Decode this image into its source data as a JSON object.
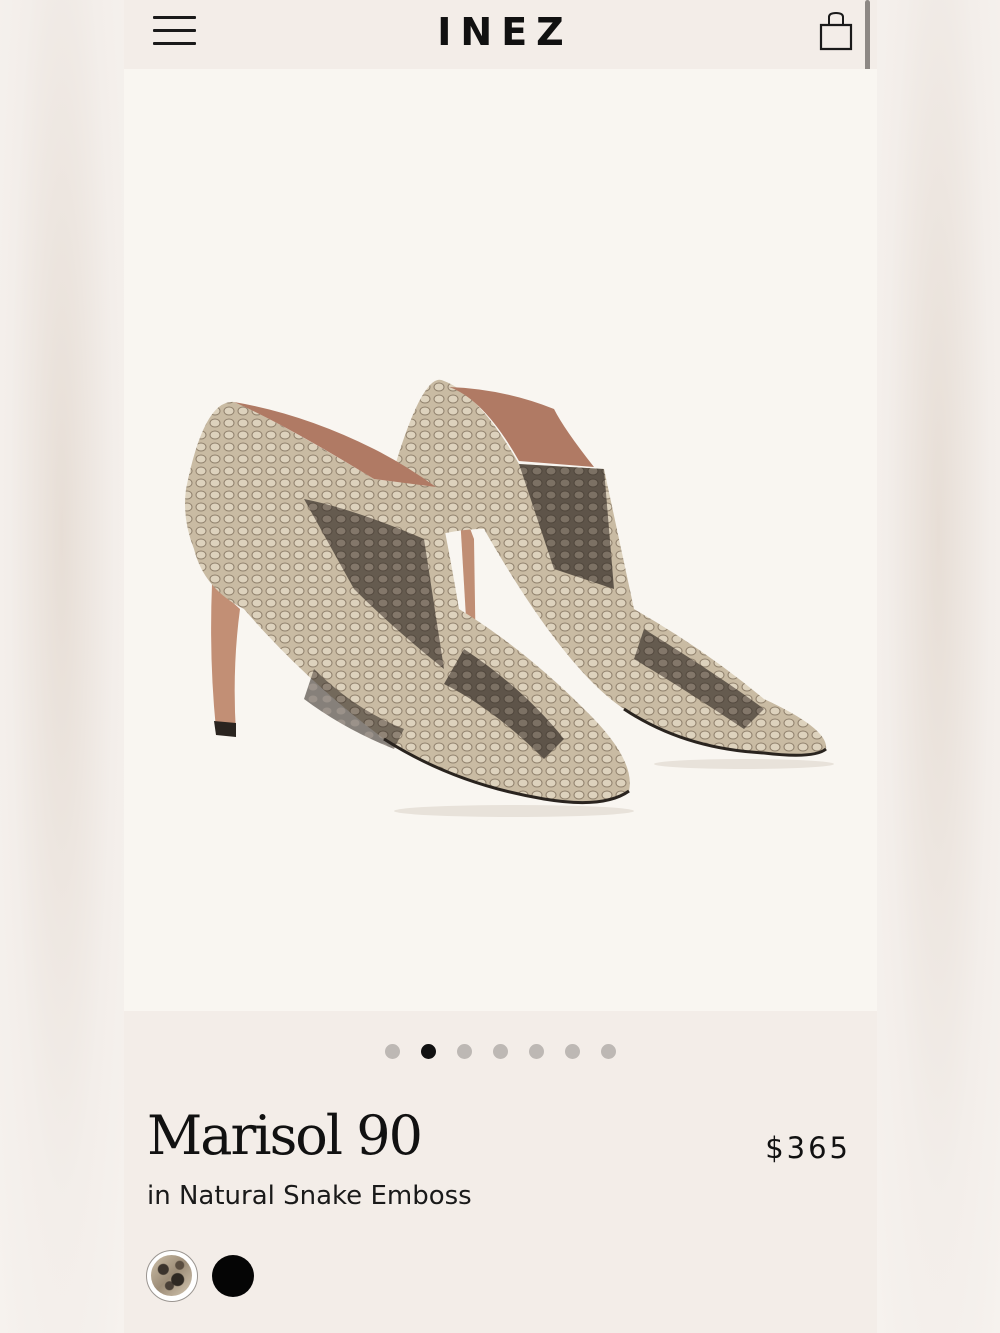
{
  "header": {
    "brand": "INEZ",
    "menu_icon": "hamburger-menu-icon",
    "cart_icon": "shopping-bag-icon"
  },
  "gallery": {
    "image_count": 7,
    "active_index": 2
  },
  "product": {
    "name": "Marisol 90",
    "color_label": "in Natural Snake Emboss",
    "price": "$365"
  },
  "swatches": [
    {
      "name": "Natural Snake Emboss",
      "color": "#b8a88f",
      "selected": true
    },
    {
      "name": "Black",
      "color": "#050505",
      "selected": false
    }
  ],
  "colors": {
    "background": "#f3ede8",
    "image_background": "#f9f6f1",
    "active_dot": "#111111",
    "inactive_dot": "#bdb8b4"
  }
}
